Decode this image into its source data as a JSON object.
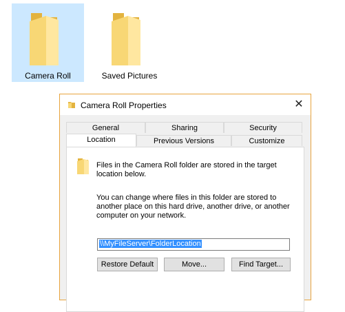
{
  "explorer": {
    "items": [
      {
        "label": "Camera Roll",
        "selected": true,
        "icon": "folder-icon"
      },
      {
        "label": "Saved Pictures",
        "selected": false,
        "icon": "folder-icon"
      }
    ],
    "selection_color": "#cce8ff"
  },
  "dialog": {
    "title": "Camera Roll Properties",
    "close_icon": "close-icon",
    "border_color": "#e8a33c",
    "tabs_row1": [
      "General",
      "Sharing",
      "Security"
    ],
    "tabs_row2": [
      "Location",
      "Previous Versions",
      "Customize"
    ],
    "active_tab": "Location",
    "description": "Files in the Camera Roll folder are stored in the target location below.",
    "info": "You can change where files in this folder are stored to another place on this hard drive, another drive, or another computer on your network.",
    "path_value": "\\\\MyFileServer\\FolderLocation",
    "buttons": {
      "restore": "Restore Default",
      "move": "Move...",
      "find": "Find Target..."
    }
  }
}
